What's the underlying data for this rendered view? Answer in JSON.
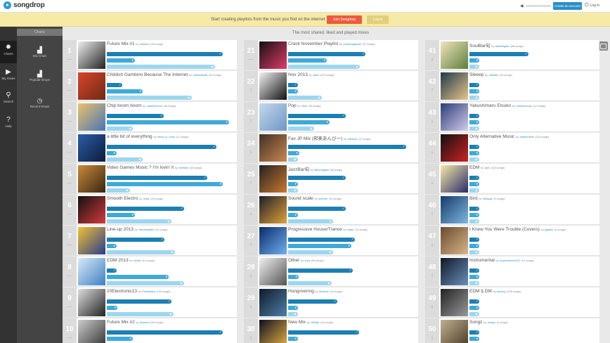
{
  "header": {
    "app_name": "songdrop",
    "create_button": "Create an account",
    "login_label": "Log in"
  },
  "banner": {
    "text": "Start creating playlists from the music you find on the internet",
    "join_button": "Join Songdrop",
    "login_button": "Log in"
  },
  "nav": [
    {
      "label": "Charts",
      "icon": "gear-icon",
      "glyph": "✹"
    },
    {
      "label": "My mixes",
      "icon": "play-icon",
      "glyph": "▶"
    },
    {
      "label": "Search",
      "icon": "search-icon",
      "glyph": "⚲"
    },
    {
      "label": "Help",
      "icon": "help-icon",
      "glyph": "?"
    }
  ],
  "subnav": {
    "heading": "Charts",
    "items": [
      {
        "label": "Mix Chart",
        "icon": "bar-chart-icon",
        "glyph": "▟"
      },
      {
        "label": "Popular Drops",
        "icon": "bar-chart-icon",
        "glyph": "▟"
      },
      {
        "label": "Recent Drops",
        "icon": "clock-icon",
        "glyph": "◷"
      }
    ]
  },
  "content": {
    "heading": "The most shared, liked and played mixes"
  },
  "colors": {
    "primary_bar": "#1c7fb3",
    "secondary_bar": "#3fa9d8",
    "tertiary_bar": "#9dd6ee",
    "rank_up": "#56b45e",
    "rank_down": "#e2614c"
  },
  "columns": [
    [
      {
        "rank": "1",
        "move": "same",
        "title": "Future Mix #1",
        "by": "by",
        "user": "ikumura",
        "count": "(96 songs)",
        "b1": 0.9,
        "b2": 0.22,
        "b3": 0.84,
        "thumb": [
          "#eeeeee",
          "#222222"
        ]
      },
      {
        "rank": "2",
        "move": "same",
        "title": "Childish Gambino  Because The Internet",
        "by": "by",
        "user": "robsoulmaat",
        "count": "(40 songs)",
        "b1": 0.12,
        "b2": 0.28,
        "b3": 0.66,
        "thumb": [
          "#d7452b",
          "#6e2a16"
        ]
      },
      {
        "rank": "3",
        "move": "same",
        "title": "Chip boom boom",
        "by": "by",
        "user": "mamimemoo",
        "count": "(38 songs)",
        "b1": 0.44,
        "b2": 0.95,
        "b3": 0.2,
        "thumb": [
          "#e9c36b",
          "#4a74b8"
        ]
      },
      {
        "rank": "4",
        "move": "same",
        "title": "a little bit of everything",
        "by": "by",
        "user": "elena_lu_rinns",
        "count": "(12 songs)",
        "b1": 0.85,
        "b2": 0.06,
        "b3": 0.28,
        "thumb": [
          "#2b5ea8",
          "#0d1b3a"
        ]
      },
      {
        "rank": "5",
        "move": "same",
        "title": "Video Games Music ? I'm lovin' it",
        "by": "by",
        "user": "teenaks",
        "count": "(45 songs)",
        "b1": 0.78,
        "b2": 0.9,
        "b3": 0.18,
        "thumb": [
          "#c98a3b",
          "#3a2510"
        ]
      },
      {
        "rank": "6",
        "move": "same",
        "title": "Smooth Electro",
        "by": "by",
        "user": "nicky",
        "count": "(16 songs)",
        "b1": 0.6,
        "b2": 0.22,
        "b3": 0.5,
        "thumb": [
          "#111111",
          "#d43a3a"
        ]
      },
      {
        "rank": "7",
        "move": "same",
        "title": "Line-up 2013",
        "by": "by",
        "user": "nikrodeighbs",
        "count": "(10 songs)",
        "b1": 0.45,
        "b2": 0.07,
        "b3": 0.53,
        "thumb": [
          "#f0c233",
          "#2a3b8c"
        ]
      },
      {
        "rank": "8",
        "move": "same",
        "title": "EDM 2013",
        "by": "by",
        "user": "zeus8",
        "count": "(41 songs)",
        "b1": 0.06,
        "b2": 0.48,
        "b3": 0.6,
        "thumb": [
          "#d9eaf7",
          "#3e7fc4"
        ]
      },
      {
        "rank": "9",
        "move": "same",
        "title": "20Electronic13",
        "by": "by",
        "user": "Feelitracks",
        "count": "(150 songs)",
        "b1": 0.5,
        "b2": 0.08,
        "b3": 0.52,
        "thumb": [
          "#dddddd",
          "#222222"
        ]
      },
      {
        "rank": "10",
        "move": "same",
        "title": "Future Mix #2",
        "by": "by",
        "user": "ikumura",
        "count": "(96 songs)",
        "b1": 0.9,
        "b2": 0.2,
        "b3": 0.5,
        "thumb": [
          "#cccccc",
          "#333333"
        ]
      }
    ],
    [
      {
        "rank": "21",
        "move": "same",
        "title": "Crack November Playlist",
        "by": "by",
        "user": "crackmagazine",
        "count": "(37 songs)",
        "b1": 0.6,
        "b2": 0.3,
        "b3": 0.56,
        "thumb": [
          "#111111",
          "#e33a6a"
        ]
      },
      {
        "rank": "22",
        "move": "up",
        "title": "Nov 2013",
        "by": "by",
        "user": "Apex",
        "count": "(101 songs)",
        "b1": 0.06,
        "b2": 0.06,
        "b3": 0.26,
        "thumb": [
          "#f2f2f2",
          "#111111"
        ]
      },
      {
        "rank": "23",
        "move": "up",
        "title": "Pop",
        "by": "by",
        "user": "simo",
        "count": "(15 songs)",
        "b1": 0.45,
        "b2": 0.32,
        "b3": 0.2,
        "thumb": [
          "#c4d9ee",
          "#6f95c4"
        ]
      },
      {
        "rank": "24",
        "move": "down",
        "title": "Fav JP Mix (邦楽あんびー)",
        "by": "by",
        "user": "fulloanp",
        "count": "(47 songs)",
        "b1": 0.92,
        "b2": 0.09,
        "b3": 0.06,
        "thumb": [
          "#403024",
          "#c98752"
        ]
      },
      {
        "rank": "25",
        "move": "up",
        "title": "JazzBar旬",
        "by": "by",
        "user": "takuroligami",
        "count": "(98 songs)",
        "b1": 0.45,
        "b2": 0.05,
        "b3": 0.05,
        "thumb": [
          "#222222",
          "#c9782e"
        ]
      },
      {
        "rank": "26",
        "move": "down",
        "title": "Sound scale",
        "by": "by",
        "user": "senrivel",
        "count": "(13 songs)",
        "b1": 0.45,
        "b2": 0.05,
        "b3": 0.35,
        "thumb": [
          "#1e1e2a",
          "#e0a23a"
        ]
      },
      {
        "rank": "27",
        "move": "up",
        "title": "Progressive House/Trance",
        "by": "by",
        "user": "sutas",
        "count": "(74 songs)",
        "b1": 0.52,
        "b2": 0.49,
        "b3": 0.35,
        "thumb": [
          "#0a2a6a",
          "#6fb0ee"
        ]
      },
      {
        "rank": "28",
        "move": "down",
        "title": "Other",
        "by": "by",
        "user": "sora",
        "count": "(30 songs)",
        "b1": 0.5,
        "b2": 0.08,
        "b3": 0.34,
        "thumb": [
          "#efefef",
          "#555555"
        ]
      },
      {
        "rank": "29",
        "move": "down",
        "title": "Hungovering",
        "by": "by",
        "user": "flinomat",
        "count": "(15 songs)",
        "b1": 0.38,
        "b2": 0.06,
        "b3": 0.06,
        "thumb": [
          "#0f1a28",
          "#4e7fa8"
        ]
      },
      {
        "rank": "30",
        "move": "down",
        "title": "New Mix",
        "by": "by",
        "user": "HikHijo",
        "count": "(16 songs)",
        "b1": 0.55,
        "b2": 0.05,
        "b3": 0.06,
        "thumb": [
          "#0c1020",
          "#e8b040"
        ]
      }
    ],
    [
      {
        "rank": "41",
        "move": "down",
        "title": "SoulBar旬",
        "by": "by",
        "user": "takurilligami",
        "count": "(68 songs)",
        "b1": 0.46,
        "b2": 0.05,
        "b3": 0.05,
        "thumb": [
          "#f3e3bf",
          "#5a7f3a"
        ]
      },
      {
        "rank": "42",
        "move": "up",
        "title": "Sleeep",
        "by": "by",
        "user": "nathans",
        "count": "(19 songs)",
        "b1": 0.06,
        "b2": 0.06,
        "b3": 0.05,
        "thumb": [
          "#1e3a4a",
          "#e9c48a"
        ]
      },
      {
        "rank": "43",
        "move": "down",
        "title": "Yakushimaru Etsuko",
        "by": "by",
        "user": "hotoseroresa",
        "count": "(12 songs)",
        "b1": 0.06,
        "b2": 0.06,
        "b3": 0.05,
        "thumb": [
          "#2d3b7a",
          "#d2ccea"
        ]
      },
      {
        "rank": "44",
        "move": "down",
        "title": "Only Alternative Music",
        "by": "by",
        "user": "katerin1996",
        "count": "(153 songs)",
        "b1": 0.05,
        "b2": 0.05,
        "b3": 0.05,
        "thumb": [
          "#111111",
          "#cc2222"
        ]
      },
      {
        "rank": "45",
        "move": "down",
        "title": "EDM",
        "by": "by",
        "user": "lyse",
        "count": "(118 songs)",
        "b1": 0.05,
        "b2": 0.05,
        "b3": 0.05,
        "thumb": [
          "#f7eaa6",
          "#2a2a6a"
        ]
      },
      {
        "rank": "46",
        "move": "up",
        "title": "Bird",
        "by": "by",
        "user": "missyay",
        "count": "(9 songs)",
        "b1": 0.05,
        "b2": 0.05,
        "b3": 0.05,
        "thumb": [
          "#163a6a",
          "#7fb6e0"
        ]
      },
      {
        "rank": "47",
        "move": "down",
        "title": "I Knew You Were Trouble (Covers)",
        "by": "by",
        "user": "jagwire",
        "count": "(8 songs)",
        "b1": 0.05,
        "b2": 0.05,
        "b3": 0.05,
        "thumb": [
          "#6a4a2e",
          "#d8b58a"
        ]
      },
      {
        "rank": "48",
        "move": "up",
        "title": "Instrumental",
        "by": "by",
        "user": "boydreamer2012",
        "count": "(12 songs)",
        "b1": 0.05,
        "b2": 0.05,
        "b3": 0.05,
        "thumb": [
          "#101828",
          "#6a8fb8"
        ]
      },
      {
        "rank": "49",
        "move": "down",
        "title": "EDM § DM",
        "by": "by",
        "user": "dedney",
        "count": "(109 songs)",
        "b1": 0.05,
        "b2": 0.05,
        "b3": 0.05,
        "thumb": [
          "#222222",
          "#999999"
        ]
      },
      {
        "rank": "50",
        "move": "down",
        "title": "Songz",
        "by": "by",
        "user": "emdyy",
        "count": "(9 songs)",
        "b1": 0.05,
        "b2": 0.05,
        "b3": 0.05,
        "thumb": [
          "#bfb090",
          "#4a3a26"
        ]
      }
    ]
  ]
}
